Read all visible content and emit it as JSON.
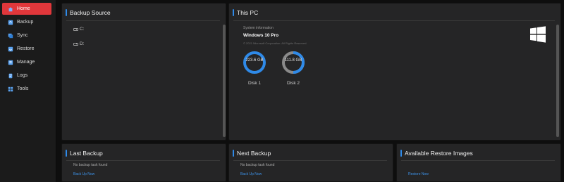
{
  "sidebar": {
    "items": [
      {
        "label": "Home",
        "icon": "home-icon",
        "active": true
      },
      {
        "label": "Backup",
        "icon": "backup-icon",
        "active": false
      },
      {
        "label": "Sync",
        "icon": "sync-icon",
        "active": false
      },
      {
        "label": "Restore",
        "icon": "restore-icon",
        "active": false
      },
      {
        "label": "Manage",
        "icon": "manage-icon",
        "active": false
      },
      {
        "label": "Logs",
        "icon": "logs-icon",
        "active": false
      },
      {
        "label": "Tools",
        "icon": "tools-icon",
        "active": false
      }
    ]
  },
  "backup_source": {
    "title": "Backup Source",
    "drives": [
      {
        "label": "C:"
      },
      {
        "label": "D:"
      }
    ]
  },
  "this_pc": {
    "title": "This PC",
    "system_info_label": "System information",
    "os_name": "Windows 10 Pro",
    "copyright": "© 2021 Microsoft Corporation. All Rights Reserved.",
    "disks": [
      {
        "name": "Disk 1",
        "value": "223.6 GB"
      },
      {
        "name": "Disk 2",
        "value": "111.8 GB"
      }
    ]
  },
  "last_backup": {
    "title": "Last Backup",
    "status": "No backup task found",
    "action": "Back Up Now"
  },
  "next_backup": {
    "title": "Next Backup",
    "status": "No backup task found",
    "action": "Back Up Now"
  },
  "restore_images": {
    "title": "Available Restore Images",
    "action": "Restore Now"
  },
  "colors": {
    "accent": "#2f8ae8",
    "active_nav": "#e0373b",
    "panel_bg": "#252526",
    "disk1_ring": "#2f8ae8",
    "disk2_ring": "#8a8a8a",
    "link": "#3d92e8"
  }
}
